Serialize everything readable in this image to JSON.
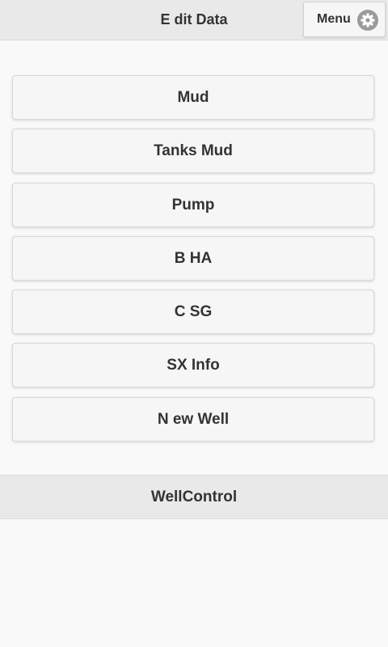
{
  "header": {
    "title": "E dit Data",
    "menu_label": "Menu",
    "menu_icon": "gear-icon"
  },
  "buttons": [
    {
      "label": "Mud"
    },
    {
      "label": "Tanks Mud"
    },
    {
      "label": "Pump"
    },
    {
      "label": "B HA"
    },
    {
      "label": "C SG"
    },
    {
      "label": "SX Info"
    },
    {
      "label": "N ew Well"
    }
  ],
  "footer": {
    "title": "WellControl"
  },
  "colors": {
    "bar_background": "#e9e9e9",
    "button_background": "#f6f6f6",
    "page_background": "#f9f9f9",
    "text": "#333333"
  }
}
